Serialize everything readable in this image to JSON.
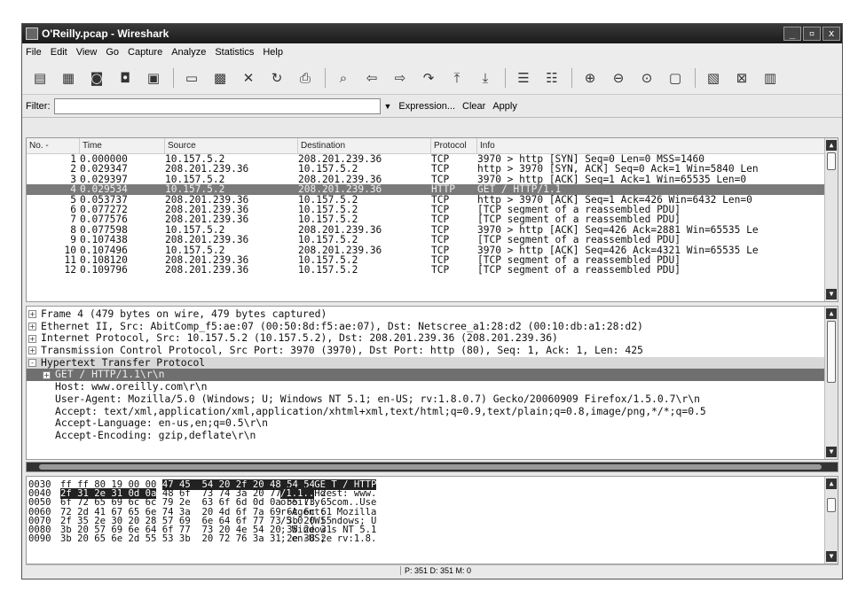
{
  "window": {
    "title": "O'Reilly.pcap - Wireshark",
    "controls": [
      "_",
      "▫",
      "x"
    ]
  },
  "menu": [
    "File",
    "Edit",
    "View",
    "Go",
    "Capture",
    "Analyze",
    "Statistics",
    "Help"
  ],
  "filter": {
    "label": "Filter:",
    "value": "",
    "expression": "Expression...",
    "clear": "Clear",
    "apply": "Apply"
  },
  "packet_list": {
    "columns": [
      "No. -",
      "Time",
      "Source",
      "Destination",
      "Protocol",
      "Info"
    ],
    "rows": [
      [
        "1",
        "0.000000",
        "10.157.5.2",
        "208.201.239.36",
        "TCP",
        "3970 > http [SYN] Seq=0 Len=0 MSS=1460"
      ],
      [
        "2",
        "0.029347",
        "208.201.239.36",
        "10.157.5.2",
        "TCP",
        "http > 3970 [SYN, ACK] Seq=0 Ack=1 Win=5840 Len"
      ],
      [
        "3",
        "0.029397",
        "10.157.5.2",
        "208.201.239.36",
        "TCP",
        "3970 > http [ACK] Seq=1 Ack=1 Win=65535 Len=0"
      ],
      [
        "4",
        "0.029534",
        "10.157.5.2",
        "208.201.239.36",
        "HTTP",
        "GET / HTTP/1.1"
      ],
      [
        "5",
        "0.053737",
        "208.201.239.36",
        "10.157.5.2",
        "TCP",
        "http > 3970 [ACK] Seq=1 Ack=426 Win=6432 Len=0"
      ],
      [
        "6",
        "0.077272",
        "208.201.239.36",
        "10.157.5.2",
        "TCP",
        "[TCP segment of a reassembled PDU]"
      ],
      [
        "7",
        "0.077576",
        "208.201.239.36",
        "10.157.5.2",
        "TCP",
        "[TCP segment of a reassembled PDU]"
      ],
      [
        "8",
        "0.077598",
        "10.157.5.2",
        "208.201.239.36",
        "TCP",
        "3970 > http [ACK] Seq=426 Ack=2881 Win=65535 Le"
      ],
      [
        "9",
        "0.107438",
        "208.201.239.36",
        "10.157.5.2",
        "TCP",
        "[TCP segment of a reassembled PDU]"
      ],
      [
        "10",
        "0.107496",
        "10.157.5.2",
        "208.201.239.36",
        "TCP",
        "3970 > http [ACK] Seq=426 Ack=4321 Win=65535 Le"
      ],
      [
        "11",
        "0.108120",
        "208.201.239.36",
        "10.157.5.2",
        "TCP",
        "[TCP segment of a reassembled PDU]"
      ],
      [
        "12",
        "0.109796",
        "208.201.239.36",
        "10.157.5.2",
        "TCP",
        "[TCP segment of a reassembled PDU]"
      ]
    ]
  },
  "details": [
    {
      "toggle": "+",
      "text": "Frame 4 (479 bytes on wire, 479 bytes captured)"
    },
    {
      "toggle": "+",
      "text": "Ethernet II, Src: AbitComp_f5:ae:07 (00:50:8d:f5:ae:07), Dst: Netscree_a1:28:d2 (00:10:db:a1:28:d2)"
    },
    {
      "toggle": "+",
      "text": "Internet Protocol, Src: 10.157.5.2 (10.157.5.2), Dst: 208.201.239.36 (208.201.239.36)"
    },
    {
      "toggle": "+",
      "text": "Transmission Control Protocol, Src Port: 3970 (3970), Dst Port: http (80), Seq: 1, Ack: 1, Len: 425"
    },
    {
      "toggle": "-",
      "text": "Hypertext Transfer Protocol"
    },
    {
      "toggle": "+",
      "text": "GET / HTTP/1.1\\r\\n"
    },
    {
      "toggle": "",
      "text": "Host: www.oreilly.com\\r\\n"
    },
    {
      "toggle": "",
      "text": "User-Agent: Mozilla/5.0 (Windows; U; Windows NT 5.1; en-US; rv:1.8.0.7) Gecko/20060909 Firefox/1.5.0.7\\r\\n"
    },
    {
      "toggle": "",
      "text": "Accept: text/xml,application/xml,application/xhtml+xml,text/html;q=0.9,text/plain;q=0.8,image/png,*/*;q=0.5"
    },
    {
      "toggle": "",
      "text": "Accept-Language: en-us,en;q=0.5\\r\\n"
    },
    {
      "toggle": "",
      "text": "Accept-Encoding: gzip,deflate\\r\\n"
    }
  ],
  "hex": [
    {
      "off": "0030",
      "pre": "ff ff 80 19 00 00 ",
      "sel": "47 45  54 20 2f 20 48 54 54 50",
      "post": "",
      "apre": "......",
      "asel": "GE T / HTTP",
      "apost": ""
    },
    {
      "off": "0040",
      "pre": "",
      "sel": "2f 31 2e 31 0d 0a",
      "post": " 48 6f  73 74 3a 20 77 77 77 2e",
      "apre": "",
      "asel": "/1.1..",
      "apost": "Ho st: www."
    },
    {
      "off": "0050",
      "pre": "6f 72 65 69 6c 6c 79 2e  63 6f 6d 0d 0a 55 73 65",
      "sel": "",
      "post": "",
      "apre": "oreilly. com..Use",
      "asel": "",
      "apost": ""
    },
    {
      "off": "0060",
      "pre": "72 2d 41 67 65 6e 74 3a  20 4d 6f 7a 69 6c 6c 61",
      "sel": "",
      "post": "",
      "apre": "r-Agent:  Mozilla",
      "asel": "",
      "apost": ""
    },
    {
      "off": "0070",
      "pre": "2f 35 2e 30 20 28 57 69  6e 64 6f 77 73 3b 20 55",
      "sel": "",
      "post": "",
      "apre": "/5.0 (Wi ndows; U",
      "asel": "",
      "apost": ""
    },
    {
      "off": "0080",
      "pre": "3b 20 57 69 6e 64 6f 77  73 20 4e 54 20 35 2e 31",
      "sel": "",
      "post": "",
      "apre": "; Window s NT 5.1",
      "asel": "",
      "apost": ""
    },
    {
      "off": "0090",
      "pre": "3b 20 65 6e 2d 55 53 3b  20 72 76 3a 31 2e 38 2e",
      "sel": "",
      "post": "",
      "apre": "; en-US;  rv:1.8.",
      "asel": "",
      "apost": ""
    }
  ],
  "status": "P: 351 D: 351 M: 0",
  "toolbar_icons": [
    "interface-list-icon",
    "capture-options-icon",
    "start-capture-icon",
    "stop-capture-icon",
    "restart-capture-icon",
    "open-file-icon",
    "save-file-icon",
    "close-file-icon",
    "reload-icon",
    "print-icon",
    "find-icon",
    "go-back-icon",
    "go-forward-icon",
    "go-to-packet-icon",
    "go-first-icon",
    "go-last-icon",
    "colorize-icon",
    "autoscroll-icon",
    "zoom-in-icon",
    "zoom-out-icon",
    "zoom-normal-icon",
    "resize-columns-icon",
    "capture-filters-icon",
    "display-filters-icon",
    "coloring-rules-icon"
  ]
}
